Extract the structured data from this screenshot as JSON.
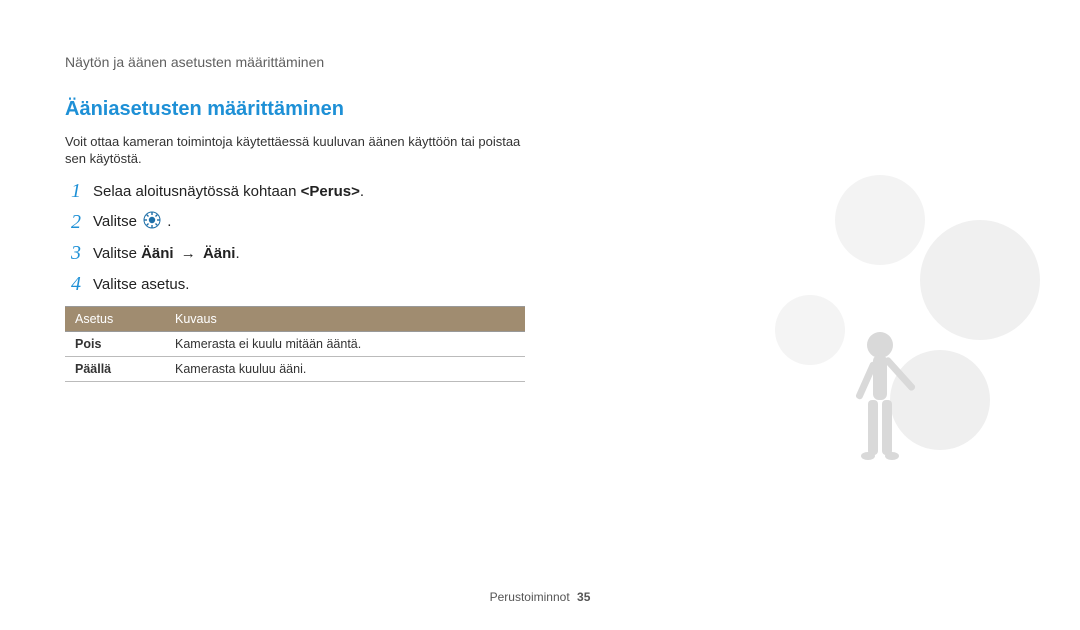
{
  "breadcrumb": "Näytön ja äänen asetusten määrittäminen",
  "section_title": "Ääniasetusten määrittäminen",
  "intro": "Voit ottaa kameran toimintoja käytettäessä kuuluvan äänen käyttöön tai poistaa sen käytöstä.",
  "steps": {
    "n1": "1",
    "s1_pre": "Selaa aloitusnäytössä kohtaan ",
    "s1_target": "<Perus>",
    "s1_post": ".",
    "n2": "2",
    "s2_pre": "Valitse ",
    "s2_post": ".",
    "n3": "3",
    "s3_pre": "Valitse ",
    "s3_a": "Ääni",
    "s3_arrow": "→",
    "s3_b": "Ääni",
    "s3_post": ".",
    "n4": "4",
    "s4": "Valitse asetus."
  },
  "table": {
    "head_setting": "Asetus",
    "head_desc": "Kuvaus",
    "rows": [
      {
        "setting": "Pois",
        "desc": "Kamerasta ei kuulu mitään ääntä."
      },
      {
        "setting": "Päällä",
        "desc": "Kamerasta kuuluu ääni."
      }
    ]
  },
  "footer": {
    "label": "Perustoiminnot",
    "page": "35"
  }
}
